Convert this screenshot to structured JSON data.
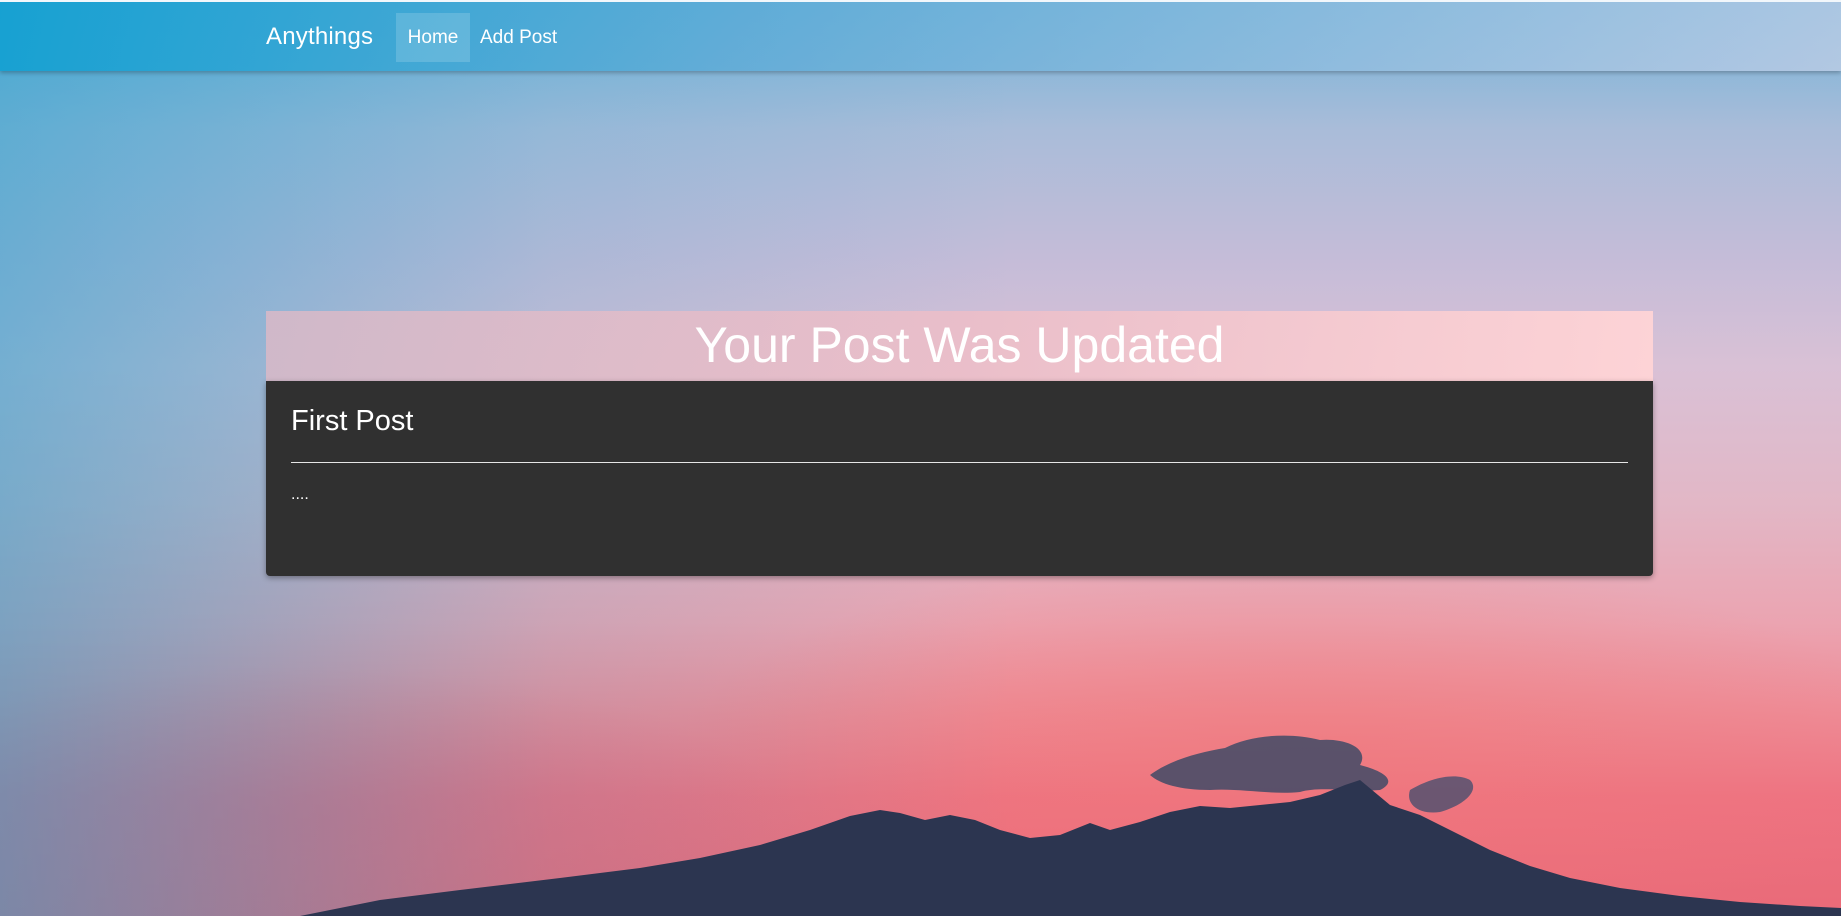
{
  "navbar": {
    "brand": "Anythings",
    "items": [
      {
        "label": "Home",
        "active": true
      },
      {
        "label": "Add Post",
        "active": false
      }
    ]
  },
  "banner": {
    "title": "Your Post Was Updated"
  },
  "post": {
    "title": "First Post",
    "body": "...."
  },
  "colors": {
    "card_background": "#303030",
    "text": "#ffffff"
  }
}
